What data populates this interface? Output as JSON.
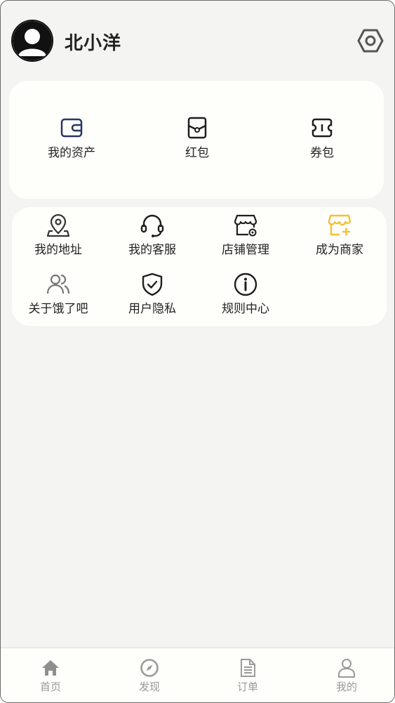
{
  "user": {
    "name": "北小洋"
  },
  "assets": [
    {
      "label": "我的资产",
      "icon": "wallet-icon"
    },
    {
      "label": "红包",
      "icon": "red-packet-icon"
    },
    {
      "label": "券包",
      "icon": "ticket-icon"
    }
  ],
  "services": [
    {
      "label": "我的地址",
      "icon": "location-pin-icon"
    },
    {
      "label": "我的客服",
      "icon": "headset-icon"
    },
    {
      "label": "店铺管理",
      "icon": "store-settings-icon"
    },
    {
      "label": "成为商家",
      "icon": "store-add-icon"
    },
    {
      "label": "关于饿了吧",
      "icon": "users-icon"
    },
    {
      "label": "用户隐私",
      "icon": "shield-check-icon"
    },
    {
      "label": "规则中心",
      "icon": "info-icon"
    }
  ],
  "tabs": [
    {
      "label": "首页",
      "icon": "home-icon"
    },
    {
      "label": "发现",
      "icon": "compass-icon"
    },
    {
      "label": "订单",
      "icon": "document-icon"
    },
    {
      "label": "我的",
      "icon": "user-icon"
    }
  ],
  "colors": {
    "background": "#f4f4f2",
    "card": "#fefefb",
    "accent_yellow": "#f5c033",
    "icon_dark": "#1e1e1e",
    "tab_gray": "#9a9a9a"
  }
}
